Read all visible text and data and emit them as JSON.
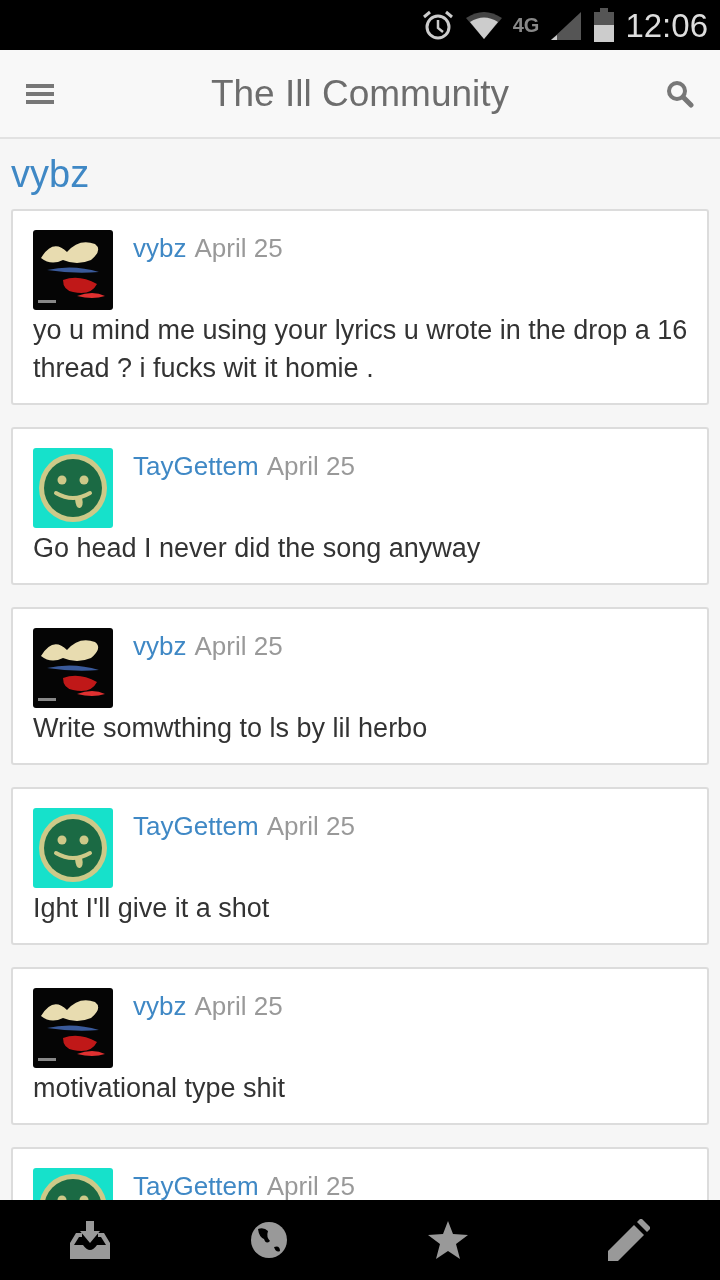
{
  "status_bar": {
    "network": "4G",
    "time": "12:06"
  },
  "header": {
    "title": "The Ill Community"
  },
  "thread_user": "vybz",
  "posts": [
    {
      "kind": "logo",
      "author": "vybz",
      "date": "April 25",
      "body": "yo u mind me using your lyrics u wrote in the drop a 16 thread ? i fucks wit it homie ."
    },
    {
      "kind": "smiley",
      "author": "TayGettem",
      "date": "April 25",
      "body": "Go head I never did the song anyway"
    },
    {
      "kind": "logo",
      "author": "vybz",
      "date": "April 25",
      "body": "Write somwthing to ls by lil herbo"
    },
    {
      "kind": "smiley",
      "author": "TayGettem",
      "date": "April 25",
      "body": "Ight I'll give it a shot"
    },
    {
      "kind": "logo",
      "author": "vybz",
      "date": "April 25",
      "body": "motivational type shit"
    },
    {
      "kind": "smiley",
      "author": "TayGettem",
      "date": "April 25"
    }
  ]
}
